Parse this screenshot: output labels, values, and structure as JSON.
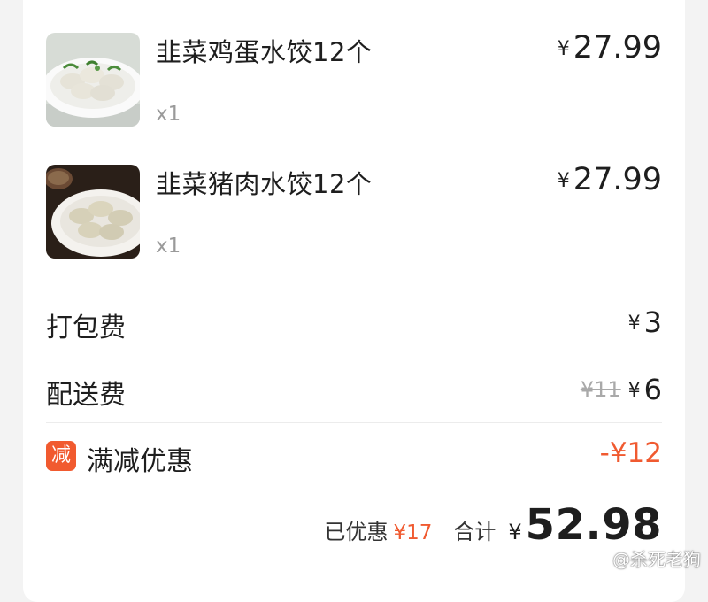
{
  "order": {
    "items": [
      {
        "name": "韭菜鸡蛋水饺12个",
        "qty": "x1",
        "currency": "¥",
        "price": "27.99",
        "image": "dumplings-on-white-plate-photo"
      },
      {
        "name": "韭菜猪肉水饺12个",
        "qty": "x1",
        "currency": "¥",
        "price": "27.99",
        "image": "dumplings-plate-dark-background-photo"
      }
    ],
    "packing_fee": {
      "label": "打包费",
      "currency": "¥",
      "value": "3"
    },
    "delivery_fee": {
      "label": "配送费",
      "original": "¥11",
      "currency": "¥",
      "value": "6"
    },
    "discount": {
      "badge": "减",
      "label": "满减优惠",
      "value": "-¥12"
    },
    "summary": {
      "saved_label": "已优惠",
      "saved_value": "¥17",
      "total_label": "合计",
      "currency": "¥",
      "total_value": "52.98"
    }
  },
  "watermark": "@杀死老狗",
  "colors": {
    "accent": "#f05a30",
    "badge_bg": "#f15a2f",
    "muted": "#9a9a9a",
    "background": "#f3f3f3",
    "card": "#ffffff"
  }
}
